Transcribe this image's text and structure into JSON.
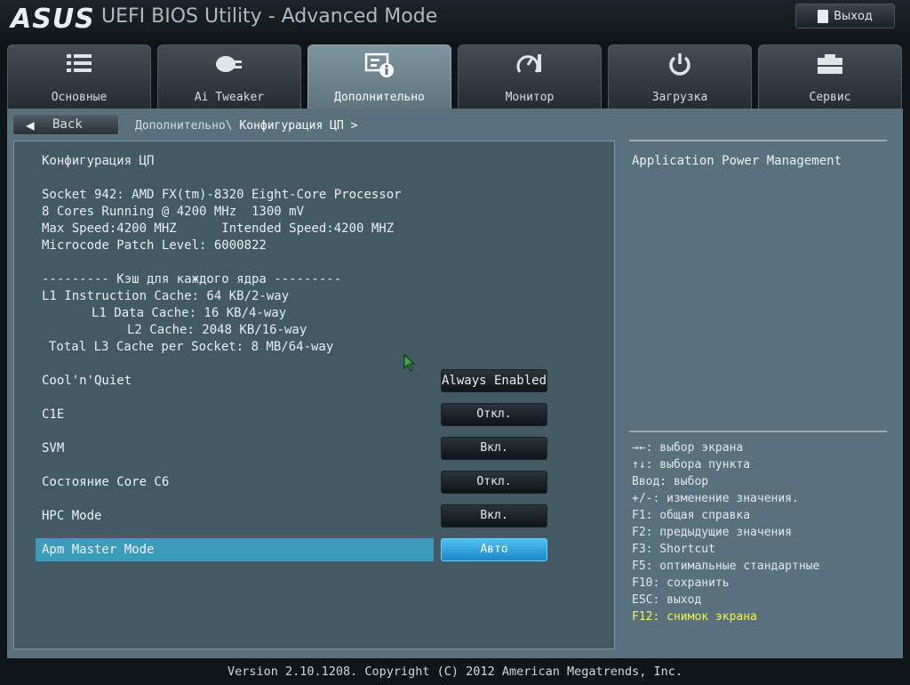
{
  "header": {
    "logo": "ASUS",
    "title": "UEFI BIOS Utility - Advanced Mode",
    "exit_label": "Выход"
  },
  "tabs": [
    {
      "label": "Основные",
      "icon": "list-icon"
    },
    {
      "label": "Ai Tweaker",
      "icon": "ai-tweaker-icon"
    },
    {
      "label": "Дополнительно",
      "icon": "advanced-info-icon",
      "active": true
    },
    {
      "label": "Монитор",
      "icon": "monitor-gauge-icon"
    },
    {
      "label": "Загрузка",
      "icon": "power-icon"
    },
    {
      "label": "Сервис",
      "icon": "toolbox-icon"
    }
  ],
  "nav": {
    "back_label": "Back",
    "breadcrumb_parent": "Дополнительно\\",
    "breadcrumb_current": "Конфигурация ЦП >"
  },
  "info": {
    "section_title": "Конфигурация ЦП",
    "cpu_lines": [
      "Socket 942: AMD FX(tm)-8320 Eight-Core Processor",
      "8 Cores Running @ 4200 MHz  1300 mV",
      "Max Speed:4200 MHZ      Intended Speed:4200 MHZ",
      "Microcode Patch Level: 6000822"
    ],
    "cache_header": "--------- Кэш для каждого ядра ---------",
    "cache_lines": [
      "L1 Instruction Cache: 64 KB/2-way",
      "L1 Data Cache: 16 KB/4-way",
      "L2 Cache: 2048 KB/16-way",
      "Total L3 Cache per Socket: 8 MB/64-way"
    ]
  },
  "options": [
    {
      "label": "Cool'n'Quiet",
      "value": "Always Enabled"
    },
    {
      "label": "C1E",
      "value": "Откл."
    },
    {
      "label": "SVM",
      "value": "Вкл."
    },
    {
      "label": "Состояние Core C6",
      "value": "Откл."
    },
    {
      "label": "HPC Mode",
      "value": "Вкл."
    },
    {
      "label": "Apm Master Mode",
      "value": "Авто",
      "selected": true
    }
  ],
  "help": {
    "title": "Application Power Management",
    "keys": [
      "→←: выбор экрана",
      "↑↓: выбора пункта",
      "Ввод: выбор",
      "+/-: изменение значения.",
      "F1: общая справка",
      "F2: предыдущие значения",
      "F3: Shortcut",
      "F5: оптимальные стандартные",
      "F10: сохранить",
      "ESC: выход",
      "F12: снимок экрана"
    ],
    "highlight_color": "#f5f250"
  },
  "footer": {
    "text": "Version 2.10.1208. Copyright (C) 2012 American Megatrends, Inc."
  }
}
